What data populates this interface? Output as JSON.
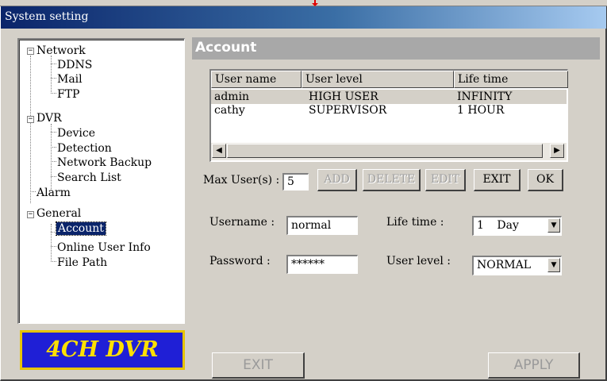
{
  "window": {
    "title": "System setting"
  },
  "tree": {
    "network": "Network",
    "ddns": "DDNS",
    "mail": "Mail",
    "ftp": "FTP",
    "dvr": "DVR",
    "device": "Device",
    "detection": "Detection",
    "network_backup": "Network Backup",
    "search_list": "Search List",
    "alarm": "Alarm",
    "general": "General",
    "account": "Account",
    "online_user_info": "Online User Info",
    "file_path": "File Path"
  },
  "logo": {
    "text": "4CH DVR"
  },
  "account": {
    "header": "Account",
    "columns": [
      "User name",
      "User level",
      "Life time"
    ],
    "rows": [
      {
        "name": "admin",
        "level": "HIGH USER",
        "life": "INFINITY"
      },
      {
        "name": "cathy",
        "level": "SUPERVISOR",
        "life": "1 HOUR"
      }
    ],
    "max_users_label": "Max User(s) :",
    "max_users_value": "5",
    "buttons": {
      "add": "ADD",
      "delete": "DELETE",
      "edit": "EDIT",
      "exit": "EXIT",
      "ok": "OK"
    },
    "username_label": "Username :",
    "username_value": "normal",
    "password_label": "Password :",
    "password_value": "******",
    "lifetime_label": "Life time :",
    "lifetime_num": "1",
    "lifetime_unit": "Day",
    "userlevel_label": "User level :",
    "userlevel_value": "NORMAL"
  },
  "footer": {
    "exit": "EXIT",
    "apply": "APPLY"
  },
  "icons": {
    "collapse": "minus-box-icon",
    "scroll_left": "left-arrow-icon",
    "scroll_right": "right-arrow-icon",
    "dropdown": "down-arrow-icon"
  },
  "colors": {
    "title_start": "#0a246a",
    "title_end": "#a6caf0",
    "logo_bg": "#1f1fd6",
    "logo_text": "#ffe000",
    "logo_border": "#e6c400",
    "marker": "#e00000"
  }
}
